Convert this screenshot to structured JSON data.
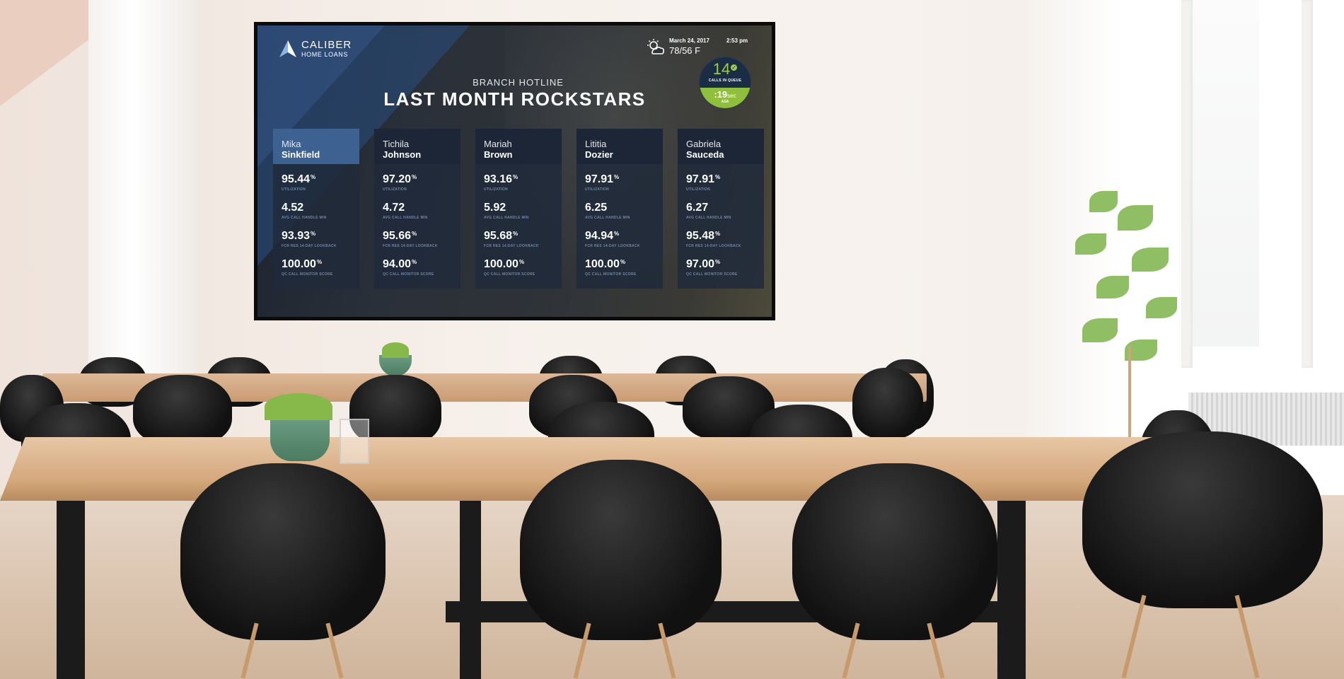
{
  "brand": {
    "line1": "CALIBER",
    "line2": "HOME LOANS"
  },
  "weather": {
    "date": "March 24, 2017",
    "time": "2:53 pm",
    "temp": "78/56 F",
    "icon": "partly-cloudy-icon"
  },
  "queue": {
    "count": "14",
    "count_label": "CALLS IN QUEUE",
    "asa_value": ":19",
    "asa_unit": "sec",
    "asa_label": "ASA"
  },
  "header": {
    "subtitle": "BRANCH HOTLINE",
    "title": "LAST MONTH ROCKSTARS"
  },
  "metric_labels": [
    "UTILIZATION",
    "AVG CALL HANDLE MIN",
    "FCR RES 14-DAY LOOKBACK",
    "QC CALL MONITOR SCORE"
  ],
  "colors": {
    "accent_blue": "#3d6191",
    "queue_green": "#8fbf3c",
    "label_blue": "#6e87a8"
  },
  "people": [
    {
      "first": "Mika",
      "last": "Sinkfield",
      "active": true,
      "metrics": [
        {
          "value": "95.44",
          "unit": "%"
        },
        {
          "value": "4.52",
          "unit": ""
        },
        {
          "value": "93.93",
          "unit": "%"
        },
        {
          "value": "100.00",
          "unit": "%"
        }
      ]
    },
    {
      "first": "Tichila",
      "last": "Johnson",
      "active": false,
      "metrics": [
        {
          "value": "97.20",
          "unit": "%"
        },
        {
          "value": "4.72",
          "unit": ""
        },
        {
          "value": "95.66",
          "unit": "%"
        },
        {
          "value": "94.00",
          "unit": "%"
        }
      ]
    },
    {
      "first": "Mariah",
      "last": "Brown",
      "active": false,
      "metrics": [
        {
          "value": "93.16",
          "unit": "%"
        },
        {
          "value": "5.92",
          "unit": ""
        },
        {
          "value": "95.68",
          "unit": "%"
        },
        {
          "value": "100.00",
          "unit": "%"
        }
      ]
    },
    {
      "first": "Lititia",
      "last": "Dozier",
      "active": false,
      "metrics": [
        {
          "value": "97.91",
          "unit": "%"
        },
        {
          "value": "6.25",
          "unit": ""
        },
        {
          "value": "94.94",
          "unit": "%"
        },
        {
          "value": "100.00",
          "unit": "%"
        }
      ]
    },
    {
      "first": "Gabriela",
      "last": "Sauceda",
      "active": false,
      "metrics": [
        {
          "value": "97.91",
          "unit": "%"
        },
        {
          "value": "6.27",
          "unit": ""
        },
        {
          "value": "95.48",
          "unit": "%"
        },
        {
          "value": "97.00",
          "unit": "%"
        }
      ]
    }
  ]
}
